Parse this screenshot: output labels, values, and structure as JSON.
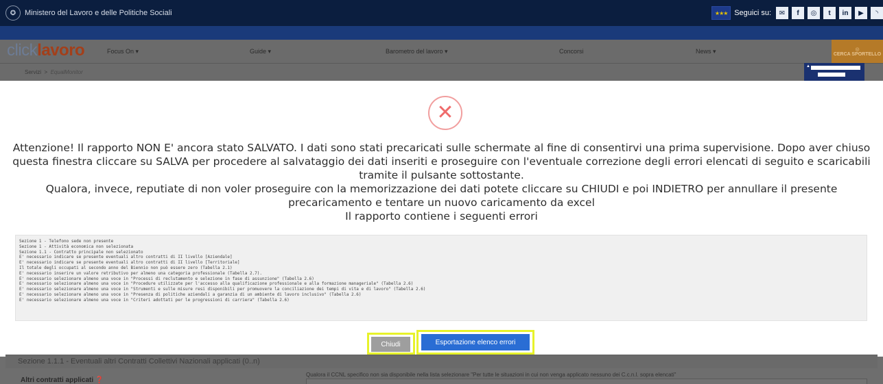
{
  "topbar": {
    "ministry_name": "Ministero del Lavoro e delle Politiche Sociali",
    "seguici": "Seguici su:",
    "social_icons": [
      "mail-icon",
      "facebook-icon",
      "instagram-icon",
      "twitter-icon",
      "linkedin-icon",
      "youtube-icon",
      "rss-icon"
    ],
    "social_glyphs": [
      "✉",
      "f",
      "◎",
      "t",
      "in",
      "▶",
      "◝"
    ]
  },
  "nav": {
    "logo_light": "click",
    "logo_bold": "lavoro",
    "items": [
      "Focus On ▾",
      "Guide ▾",
      "Barometro del lavoro ▾",
      "Concorsi",
      "News ▾"
    ],
    "cerca": "CERCA SPORTELLO"
  },
  "breadcrumb": {
    "servizi": "Servizi",
    "separator": ">",
    "current": "EqualMonitor"
  },
  "modal": {
    "icon": "error-x-icon",
    "message_line1": "Attenzione! Il rapporto NON E' ancora stato SALVATO. I dati sono stati precaricati sulle schermate al fine di consentirvi una prima supervisione. Dopo aver chiuso questa finestra cliccare su SALVA per procedere al salvataggio dei dati inseriti e proseguire con l'eventuale correzione degli errori elencati di seguito e scaricabili tramite il pulsante sottostante.",
    "message_line2": "Qualora, invece, reputiate di non voler proseguire con la memorizzazione dei dati potete cliccare su CHIUDI e poi INDIETRO per annullare il presente precaricamento e tentare un nuovo caricamento da excel",
    "message_line3": "Il rapporto contiene i seguenti errori",
    "errors": [
      "Sezione 1 - Telefono sede non presente",
      "Sezione 1 - Attività economica non selezionata",
      "Sezione 1.1 - Contratto principale non selezionato",
      "E' necessario indicare se presente eventuali altro contratti di II livello [Aziendale]",
      "E' necessario indicare se presente eventuali altro contratti di II livello [Territoriale]",
      "Il totale degli occupati al secondo anno del Biennio non può essere zero (Tabella 2.1)",
      "E' necessario inserire un valore retributivo per almeno una categoria professionale (Tabella 2.7).",
      "E' necessario selezionare almeno una voce in \"Processi di reclutamento e selezione in fase di assunzione\" (Tabella 2.6)",
      "E' necessario selezionare almeno una voce in \"Procedure utilizzate per l'accesso alla qualificazione professionale e alla formazione manageriale\" (Tabella 2.6)",
      "E' necessario selezionare almeno una voce in \"Strumenti e sulle misure resi disponibili per promuovere la conciliazione dei tempi di vita e di lavoro\" (Tabella 2.6)",
      "E' necessario selezionare almeno una voce in \"Presenza di politiche aziendali a garanzia di un ambiente di lavoro inclusivo\" (Tabella 2.6)",
      "E' necessario selezionare almeno una voce in \"Criteri adottati per le progressioni di carriera\" (Tabella 2.6)"
    ],
    "btn_close": "Chiudi",
    "btn_export": "Esportazione elenco errori"
  },
  "below": {
    "section_title": "Sezione 1.1.1 - Eventuali altri Contratti Collettivi Nazionali applicati (0..n)",
    "altri_label": "Altri contratti applicati ❓",
    "hint": "Qualora il CCNL specifico non sia disponibile nella lista selezionare \"Per tutte le situazioni in cui non venga applicato nessuno dei C.c.n.l. sopra elencati\""
  }
}
